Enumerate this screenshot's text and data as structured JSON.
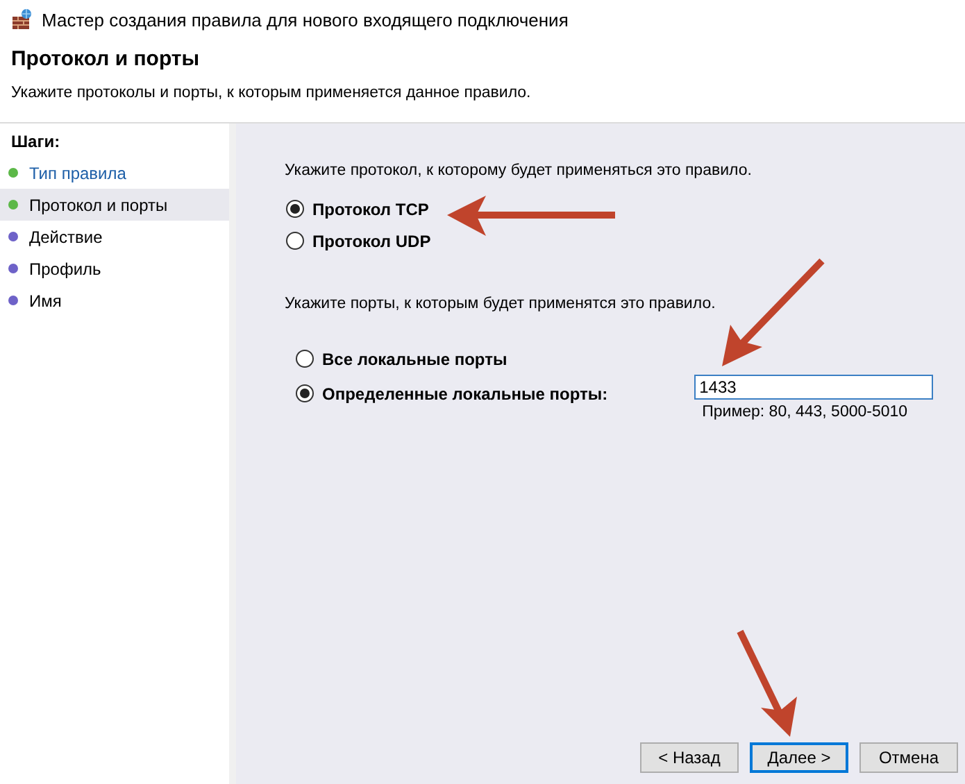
{
  "window": {
    "title": "Мастер создания правила для нового входящего подключения"
  },
  "header": {
    "title": "Протокол и порты",
    "subtitle": "Укажите протоколы и порты, к которым применяется данное правило."
  },
  "steps": {
    "heading": "Шаги:",
    "items": [
      {
        "label": "Тип правила",
        "selected": false,
        "link": true,
        "color": "#5cb848"
      },
      {
        "label": "Протокол и порты",
        "selected": true,
        "link": false,
        "color": "#5cb848"
      },
      {
        "label": "Действие",
        "selected": false,
        "link": false,
        "color": "#6e62c8"
      },
      {
        "label": "Профиль",
        "selected": false,
        "link": false,
        "color": "#6e62c8"
      },
      {
        "label": "Имя",
        "selected": false,
        "link": false,
        "color": "#6e62c8"
      }
    ]
  },
  "protocol": {
    "prompt": "Укажите протокол, к которому будет применяться это правило.",
    "options": [
      {
        "label": "Протокол TCP",
        "selected": true
      },
      {
        "label": "Протокол UDP",
        "selected": false
      }
    ]
  },
  "ports": {
    "prompt": "Укажите порты, к которым будет применятся это правило.",
    "options": [
      {
        "label": "Все локальные порты",
        "selected": false
      },
      {
        "label": "Определенные локальные порты:",
        "selected": true
      }
    ],
    "value": "1433",
    "hint": "Пример: 80, 443, 5000-5010"
  },
  "buttons": [
    {
      "label": "< Назад",
      "focused": false
    },
    {
      "label": "Далее >",
      "focused": true
    },
    {
      "label": "Отмена",
      "focused": false
    }
  ]
}
